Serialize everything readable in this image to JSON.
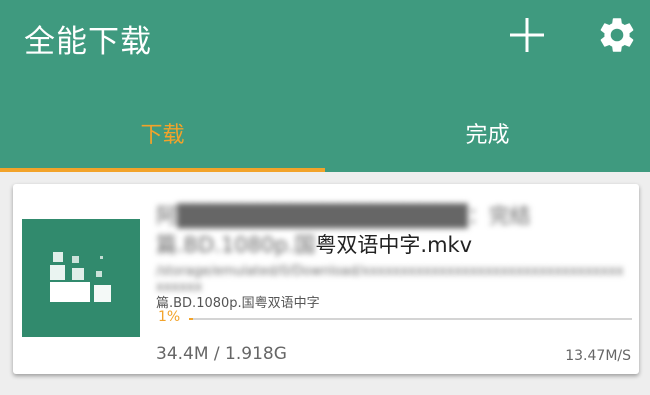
{
  "app": {
    "title": "全能下载"
  },
  "header": {
    "add_icon": "plus-icon",
    "settings_icon": "gear-icon"
  },
  "tabs": [
    {
      "label": "下载",
      "active": true
    },
    {
      "label": "完成",
      "active": false
    }
  ],
  "colors": {
    "primary": "#3f9a7f",
    "accent": "#f2a32a",
    "thumbnail": "#318a6d"
  },
  "download": {
    "title_blurred": "阿██████████████████：完结",
    "title_tail_blurred": "篇.BD.1080p.国",
    "title_tail": "粤双语中字.mkv",
    "path_blurred": "/storage/emulated/0/Download/xxxxxxxxxxxxxxxxxxxxxxxxxxxxxxxxxxxxxxxx",
    "path_tail": "篇.BD.1080p.国粤双语中字",
    "progress_label": "1%",
    "progress_percent": 1,
    "size": "34.4M / 1.918G",
    "speed": "13.47M/S",
    "thumbnail_icon": "file-blocks-icon"
  }
}
